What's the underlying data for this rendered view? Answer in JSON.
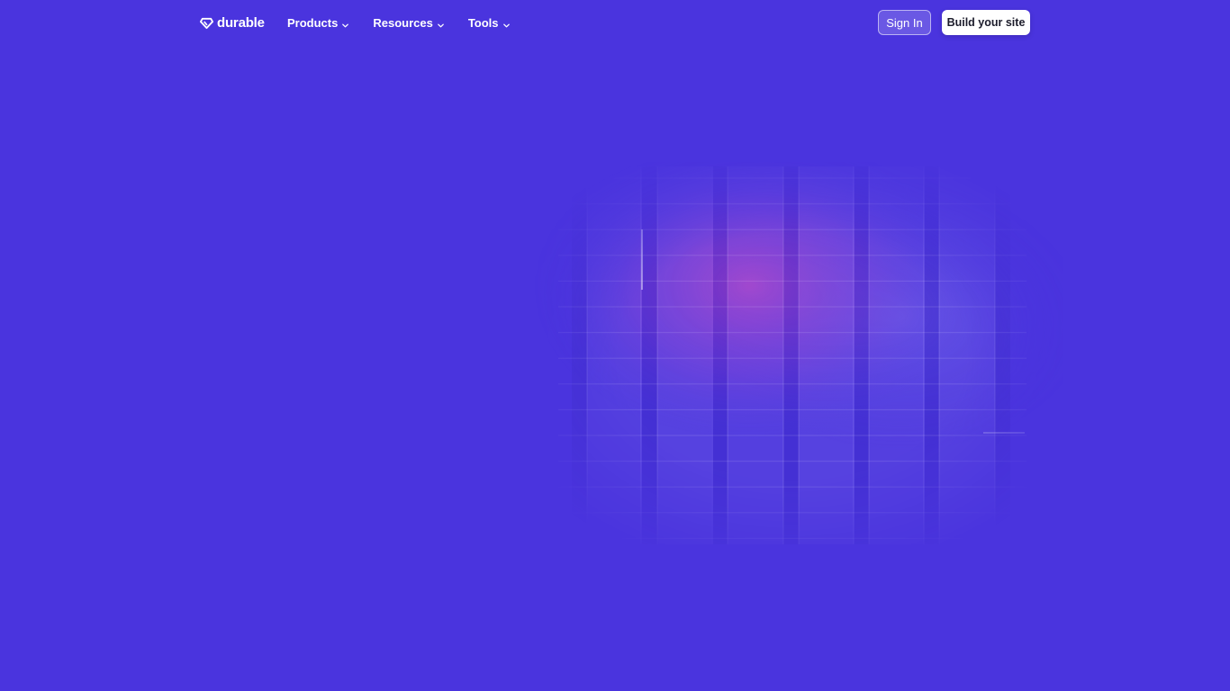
{
  "nav": {
    "logo": {
      "text": "durable",
      "icon": "diamond-logo-icon"
    },
    "menu": [
      {
        "label": "Products",
        "icon": "chevron-down-icon"
      },
      {
        "label": "Resources",
        "icon": "chevron-down-icon"
      },
      {
        "label": "Tools",
        "icon": "chevron-down-icon"
      }
    ],
    "sign_in_label": "Sign In",
    "build_label": "Build your site"
  },
  "colors": {
    "background": "#4a34de",
    "accent_glow": "#a43cc8",
    "button_text": "#1b1b2a"
  }
}
